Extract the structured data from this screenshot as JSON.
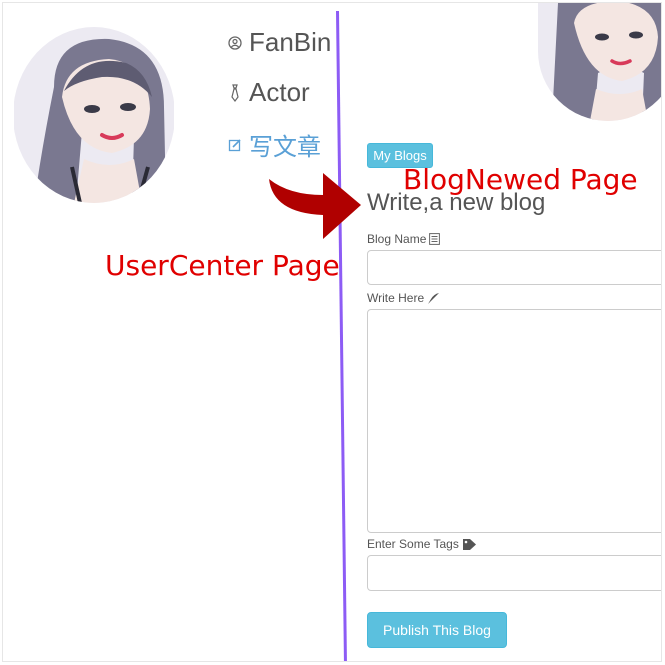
{
  "user_center": {
    "name": "FanBin",
    "role": "Actor",
    "write_link": "写文章"
  },
  "blog_new": {
    "my_blogs_button": "My Blogs",
    "heading": "Write,a new blog",
    "blog_name_label": "Blog Name",
    "blog_name_value": "",
    "write_label": "Write Here",
    "write_value": "",
    "tags_label": "Enter Some Tags",
    "tags_value": "",
    "publish_button": "Publish This Blog"
  },
  "annotations": {
    "blog_newed_page": "BlogNewed Page",
    "user_center_page": "UserCenter Page"
  },
  "colors": {
    "accent": "#5bc0de",
    "link": "#5aa0d6",
    "divider": "#8d5cf5",
    "annotation": "#e00000",
    "arrow": "#b00000"
  },
  "icons": {
    "name": "user-circle-icon",
    "role": "tie-icon",
    "write": "edit-icon",
    "blog_name": "document-icon",
    "write_here": "feather-icon",
    "tags": "tag-icon"
  }
}
